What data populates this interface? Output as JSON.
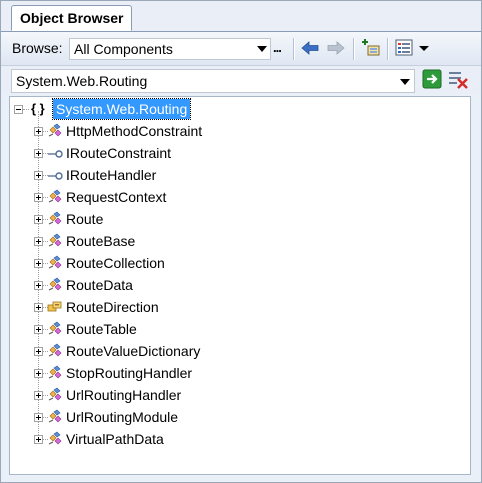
{
  "tab": {
    "title": "Object Browser"
  },
  "toolbar": {
    "browse_label": "Browse:",
    "browse_value": "All Components",
    "ellipsis": "...",
    "icons": [
      "back-arrow-icon",
      "forward-arrow-icon",
      "add-reference-icon",
      "settings-menu-icon"
    ]
  },
  "path": {
    "value": "System.Web.Routing"
  },
  "tree": {
    "root": {
      "label": "System.Web.Routing",
      "icon": "namespace-braces-icon"
    },
    "items": [
      {
        "label": "HttpMethodConstraint",
        "icon": "class-icon"
      },
      {
        "label": "IRouteConstraint",
        "icon": "interface-icon"
      },
      {
        "label": "IRouteHandler",
        "icon": "interface-icon"
      },
      {
        "label": "RequestContext",
        "icon": "class-icon"
      },
      {
        "label": "Route",
        "icon": "class-icon"
      },
      {
        "label": "RouteBase",
        "icon": "class-icon"
      },
      {
        "label": "RouteCollection",
        "icon": "class-icon"
      },
      {
        "label": "RouteData",
        "icon": "class-icon"
      },
      {
        "label": "RouteDirection",
        "icon": "enum-icon"
      },
      {
        "label": "RouteTable",
        "icon": "class-icon"
      },
      {
        "label": "RouteValueDictionary",
        "icon": "class-icon"
      },
      {
        "label": "StopRoutingHandler",
        "icon": "class-icon"
      },
      {
        "label": "UrlRoutingHandler",
        "icon": "class-icon"
      },
      {
        "label": "UrlRoutingModule",
        "icon": "class-icon"
      },
      {
        "label": "VirtualPathData",
        "icon": "class-icon"
      }
    ]
  },
  "colors": {
    "selection": "#3399ff",
    "go_button": "#2e9b3a",
    "clear_button": "#d42a2a"
  }
}
